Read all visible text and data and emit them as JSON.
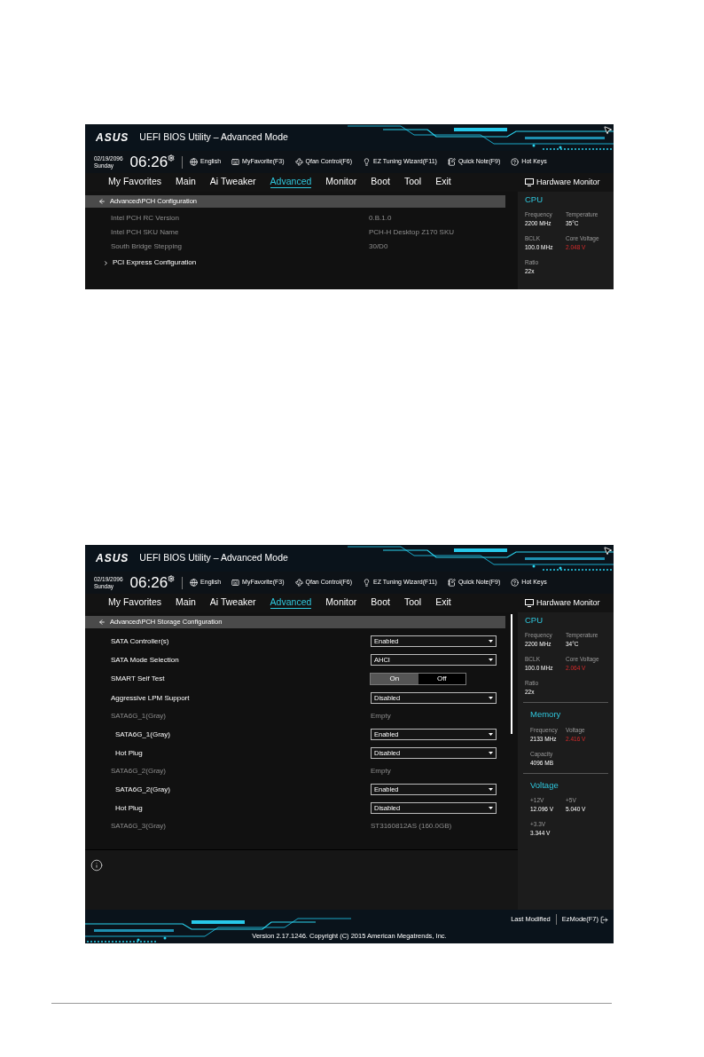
{
  "screens": [
    {
      "logo": "ASUS",
      "title": "UEFI BIOS Utility – Advanced Mode",
      "date": "02/19/2096",
      "day": "Sunday",
      "time": "06:26",
      "toolbar": [
        {
          "label": "English"
        },
        {
          "label": "MyFavorite(F3)"
        },
        {
          "label": "Qfan Control(F6)"
        },
        {
          "label": "EZ Tuning Wizard(F11)"
        },
        {
          "label": "Quick Note(F9)"
        },
        {
          "label": "Hot Keys"
        }
      ],
      "tabs": [
        {
          "label": "My Favorites",
          "selected": false
        },
        {
          "label": "Main",
          "selected": false
        },
        {
          "label": "Ai Tweaker",
          "selected": false
        },
        {
          "label": "Advanced",
          "selected": true
        },
        {
          "label": "Monitor",
          "selected": false
        },
        {
          "label": "Boot",
          "selected": false
        },
        {
          "label": "Tool",
          "selected": false
        },
        {
          "label": "Exit",
          "selected": false
        }
      ],
      "breadcrumb": "Advanced\\PCH Configuration",
      "items": [
        {
          "kind": "info",
          "label": "Intel PCH RC Version",
          "value": "0.B.1.0"
        },
        {
          "kind": "info",
          "label": "Intel PCH SKU Name",
          "value": "PCH-H Desktop Z170 SKU"
        },
        {
          "kind": "info",
          "label": "South Bridge Stepping",
          "value": "30/D0"
        },
        {
          "kind": "submenu",
          "label": "PCI Express Configuration"
        }
      ],
      "hardware_monitor": {
        "title": "Hardware Monitor",
        "sections": [
          {
            "title": "CPU",
            "fields": [
              {
                "label": "Frequency",
                "value": "2200 MHz",
                "alert": false
              },
              {
                "label": "Temperature",
                "value": "35°C",
                "alert": false
              },
              {
                "label": "BCLK",
                "value": "100.0 MHz",
                "alert": false
              },
              {
                "label": "Core Voltage",
                "value": "2.048 V",
                "alert": true
              },
              {
                "label": "Ratio",
                "value": "22x",
                "alert": false
              }
            ]
          }
        ]
      }
    },
    {
      "logo": "ASUS",
      "title": "UEFI BIOS Utility – Advanced Mode",
      "date": "02/19/2096",
      "day": "Sunday",
      "time": "06:26",
      "toolbar": [
        {
          "label": "English"
        },
        {
          "label": "MyFavorite(F3)"
        },
        {
          "label": "Qfan Control(F6)"
        },
        {
          "label": "EZ Tuning Wizard(F11)"
        },
        {
          "label": "Quick Note(F9)"
        },
        {
          "label": "Hot Keys"
        }
      ],
      "tabs": [
        {
          "label": "My Favorites",
          "selected": false
        },
        {
          "label": "Main",
          "selected": false
        },
        {
          "label": "Ai Tweaker",
          "selected": false
        },
        {
          "label": "Advanced",
          "selected": true
        },
        {
          "label": "Monitor",
          "selected": false
        },
        {
          "label": "Boot",
          "selected": false
        },
        {
          "label": "Tool",
          "selected": false
        },
        {
          "label": "Exit",
          "selected": false
        }
      ],
      "breadcrumb": "Advanced\\PCH Storage Configuration",
      "items": [
        {
          "kind": "dropdown",
          "label": "SATA Controller(s)",
          "value": "Enabled"
        },
        {
          "kind": "dropdown",
          "label": "SATA Mode Selection",
          "value": "AHCI"
        },
        {
          "kind": "toggle",
          "label": "SMART Self Test",
          "options": [
            {
              "label": "On",
              "selected": true
            },
            {
              "label": "Off",
              "selected": false
            }
          ]
        },
        {
          "kind": "dropdown",
          "label": "Aggressive LPM Support",
          "value": "Disabled"
        },
        {
          "kind": "status",
          "label": "SATA6G_1(Gray)",
          "value": "Empty",
          "children": [
            {
              "kind": "dropdown",
              "label": "SATA6G_1(Gray)",
              "value": "Enabled"
            },
            {
              "kind": "dropdown",
              "label": "Hot Plug",
              "value": "Disabled"
            }
          ]
        },
        {
          "kind": "status",
          "label": "SATA6G_2(Gray)",
          "value": "Empty",
          "children": [
            {
              "kind": "dropdown",
              "label": "SATA6G_2(Gray)",
              "value": "Enabled"
            },
            {
              "kind": "dropdown",
              "label": "Hot Plug",
              "value": "Disabled"
            }
          ]
        },
        {
          "kind": "status",
          "label": "SATA6G_3(Gray)",
          "value": "ST3160812AS (160.0GB)"
        }
      ],
      "hardware_monitor": {
        "title": "Hardware Monitor",
        "sections": [
          {
            "title": "CPU",
            "fields": [
              {
                "label": "Frequency",
                "value": "2200 MHz",
                "alert": false
              },
              {
                "label": "Temperature",
                "value": "34°C",
                "alert": false
              },
              {
                "label": "BCLK",
                "value": "100.0 MHz",
                "alert": false
              },
              {
                "label": "Core Voltage",
                "value": "2.064 V",
                "alert": true
              },
              {
                "label": "Ratio",
                "value": "22x",
                "alert": false
              }
            ]
          },
          {
            "title": "Memory",
            "fields": [
              {
                "label": "Frequency",
                "value": "2133 MHz",
                "alert": false
              },
              {
                "label": "Voltage",
                "value": "2.416 V",
                "alert": true
              },
              {
                "label": "Capacity",
                "value": "4096 MB",
                "alert": false
              }
            ]
          },
          {
            "title": "Voltage",
            "fields": [
              {
                "label": "+12V",
                "value": "12.096 V",
                "alert": false
              },
              {
                "label": "+5V",
                "value": "5.040 V",
                "alert": false
              },
              {
                "label": "+3.3V",
                "value": "3.344 V",
                "alert": false
              }
            ]
          }
        ]
      },
      "footer": {
        "last_modified": "Last Modified",
        "ez_mode": "EzMode(F7)",
        "version": "Version 2.17.1246. Copyright (C) 2015 American Megatrends, Inc."
      }
    }
  ]
}
